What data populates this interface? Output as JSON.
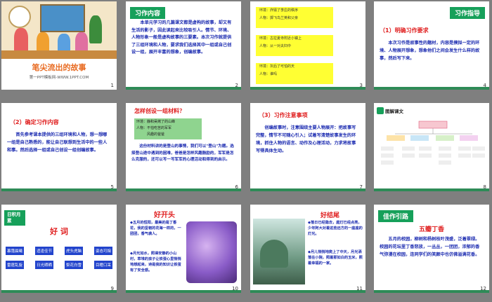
{
  "slide1": {
    "title": "笔尖流出的故事",
    "subtitle": "第一PPT模板网-WWW.1PPT.COM",
    "num": "1"
  },
  "slide2": {
    "tag": "习作内容",
    "body": "本单元学习的几篇课文都是虚构的故事，却又有生活的影子，因此读起来比较吸引人。情节、环境、人物形象一般是虚构故事的三要素。本次习作就提供了三组环境和人物，要求我们选择其中一组或自己创设一组，展开丰富的想象，创编故事。",
    "num": "2"
  },
  "slide3": {
    "rows": [
      [
        "环境：",
        "炸毁了李庄的秩序"
      ],
      [
        "人物：",
        "掷飞鸟兰英和父亲"
      ],
      [
        "环境：",
        "古拉夏寺附近小镇上"
      ],
      [
        "人物：",
        "从一对夫妇中"
      ],
      [
        "环境：",
        "灰后了可怕的天"
      ],
      [
        "人物：",
        "谁吗"
      ]
    ],
    "num": "3"
  },
  "slide4": {
    "tag": "习作指导",
    "heading": "（1）明确习作要求",
    "body": "本次习作是故事性的题材，内容是摸拟一定的环境、人物展开想象，想象他们之间会发生什么样的故事，然后写下来。",
    "num": "4"
  },
  "slide5": {
    "heading": "（2）确定习作内容",
    "body": "首先参考课本提供的三组环境和人物，想一想哪一组是自己熟悉的，能让自己联想到生活中的一些人和事。然后选择一组或自己创设一组创编故事。",
    "num": "5"
  },
  "slide6": {
    "heading": "怎样创设一组材料？",
    "box": [
      "环境：静和昊烤了的山峰",
      "人物：不怕吃苦的军军",
      "　　　风趣的爸爸"
    ],
    "body": "这份材料讲的是登山的事情，我们可以\"登山\"为题。选择登山途中遇到的困难，爸爸是怎样风趣鼓励的，军军是怎么克服的，还可以写一写军军的心理活动和得到的启示。",
    "num": "6"
  },
  "slide7": {
    "heading": "（3）习作注意事项",
    "body": "创编故事时，注意围绕主要人物展开：把故事写完整，情节不可随心引入；试着写清楚故事发生的环境，抓住人物的语言、动作及心理活动，力求将故事写得具体生动。",
    "num": "7"
  },
  "slide8": {
    "label": "图解课文",
    "num": "8"
  },
  "slide9": {
    "tag": "日积月累",
    "title": "好 词",
    "words": [
      [
        "暮霭晨曦",
        "适逢佳节",
        "虎头虎脑",
        "姿态可掬"
      ],
      [
        "雷霆乱旋",
        "日光晒晒",
        "梨花白雪",
        "目瞪口呆"
      ]
    ],
    "num": "9"
  },
  "slide10": {
    "title": "好开头",
    "p1": "◆五月的恒阳，最美的是丁香花，我的坚韧的花海一样的，一团团，香气袭人。",
    "p2": "◆月光如水，照得安静的小山村，草堆的孩子让铁蛋心里悄悄地想起来，诗是我的知识让铁蛋有了安全感。",
    "num": "10"
  },
  "slide11": {
    "title": "好结尾",
    "p1": "◆落日已经隐去，庭灯已经点亮，少年阿大对着这些远方的一座座的灯光。",
    "p2": "◆月儿悄悄地爬上了中天，月光洒落在小院，照着那如白的玉米，照着幸福的一家。",
    "num": "11"
  },
  "slide12": {
    "tag": "佳作引路",
    "title": "五瓣丁香",
    "body": "五月的校园，柳树和杨树枝叶茂盛，泛着翠绿。校园的花坛里丁香怒放，一丛丛，一团团，浓郁的香气弥漫在校园，连同学们的笑颜中也仿佛溢满花香。",
    "num": "12"
  },
  "colors": {
    "green": "#16a05a",
    "blue": "#1a2ab0",
    "yellow": "#ffff33",
    "red": "#e02020",
    "gray": "#7f7f7f"
  }
}
